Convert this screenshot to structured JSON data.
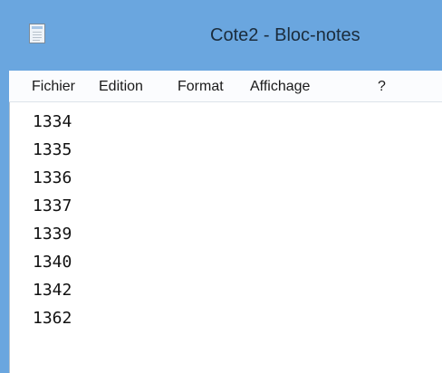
{
  "window": {
    "title": "Cote2 - Bloc-notes",
    "icon": "notepad-icon",
    "accent_color": "#6aa6df"
  },
  "menu": {
    "items": [
      "Fichier",
      "Edition",
      "Format",
      "Affichage",
      "?"
    ]
  },
  "editor": {
    "lines": [
      "1334",
      "1335",
      "1336",
      "1337",
      "1339",
      "1340",
      "1342",
      "1362"
    ]
  }
}
